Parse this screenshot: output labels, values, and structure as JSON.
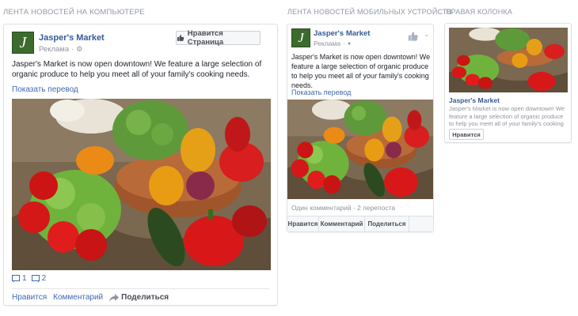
{
  "sections": {
    "desktop": "ЛЕНТА НОВОСТЕЙ НА КОМПЬЮТЕРЕ",
    "mobile": "ЛЕНТА НОВОСТЕЙ МОБИЛЬНЫХ УСТРОЙСТВ",
    "right": "ПРАВАЯ КОЛОНКА"
  },
  "page": {
    "name": "Jasper's Market",
    "logo_letter": "J",
    "sponsored": "Реклама"
  },
  "desktop_post": {
    "like_page_label": "Нравится Страница",
    "text": "Jasper's Market is now open downtown! We feature a large selection of organic produce to help you meet all of your family's cooking needs.",
    "translate": "Показать перевод",
    "likes_count": "1",
    "comments_count": "2",
    "actions": {
      "like": "Нравится",
      "comment": "Комментарий",
      "share": "Поделиться"
    }
  },
  "mobile_post": {
    "text": "Jasper's Market is now open downtown! We feature a large selection of organic produce to help you meet all of your family's cooking needs.",
    "translate": "Показать перевод",
    "stats": "Один комментарий · 2 перепоста",
    "actions": {
      "like": "Нравится",
      "comment": "Комментарий",
      "share": "Поделиться"
    }
  },
  "right_column": {
    "title": "Jasper's Market",
    "text": "Jasper's Market is now open downtown! We feature a large selection of organic produce to help you meet all of your family's cooking needs to h...",
    "like": "Нравится"
  },
  "colors": {
    "link": "#365899",
    "muted": "#90949c",
    "logo_bg": "#3c6b2e"
  }
}
